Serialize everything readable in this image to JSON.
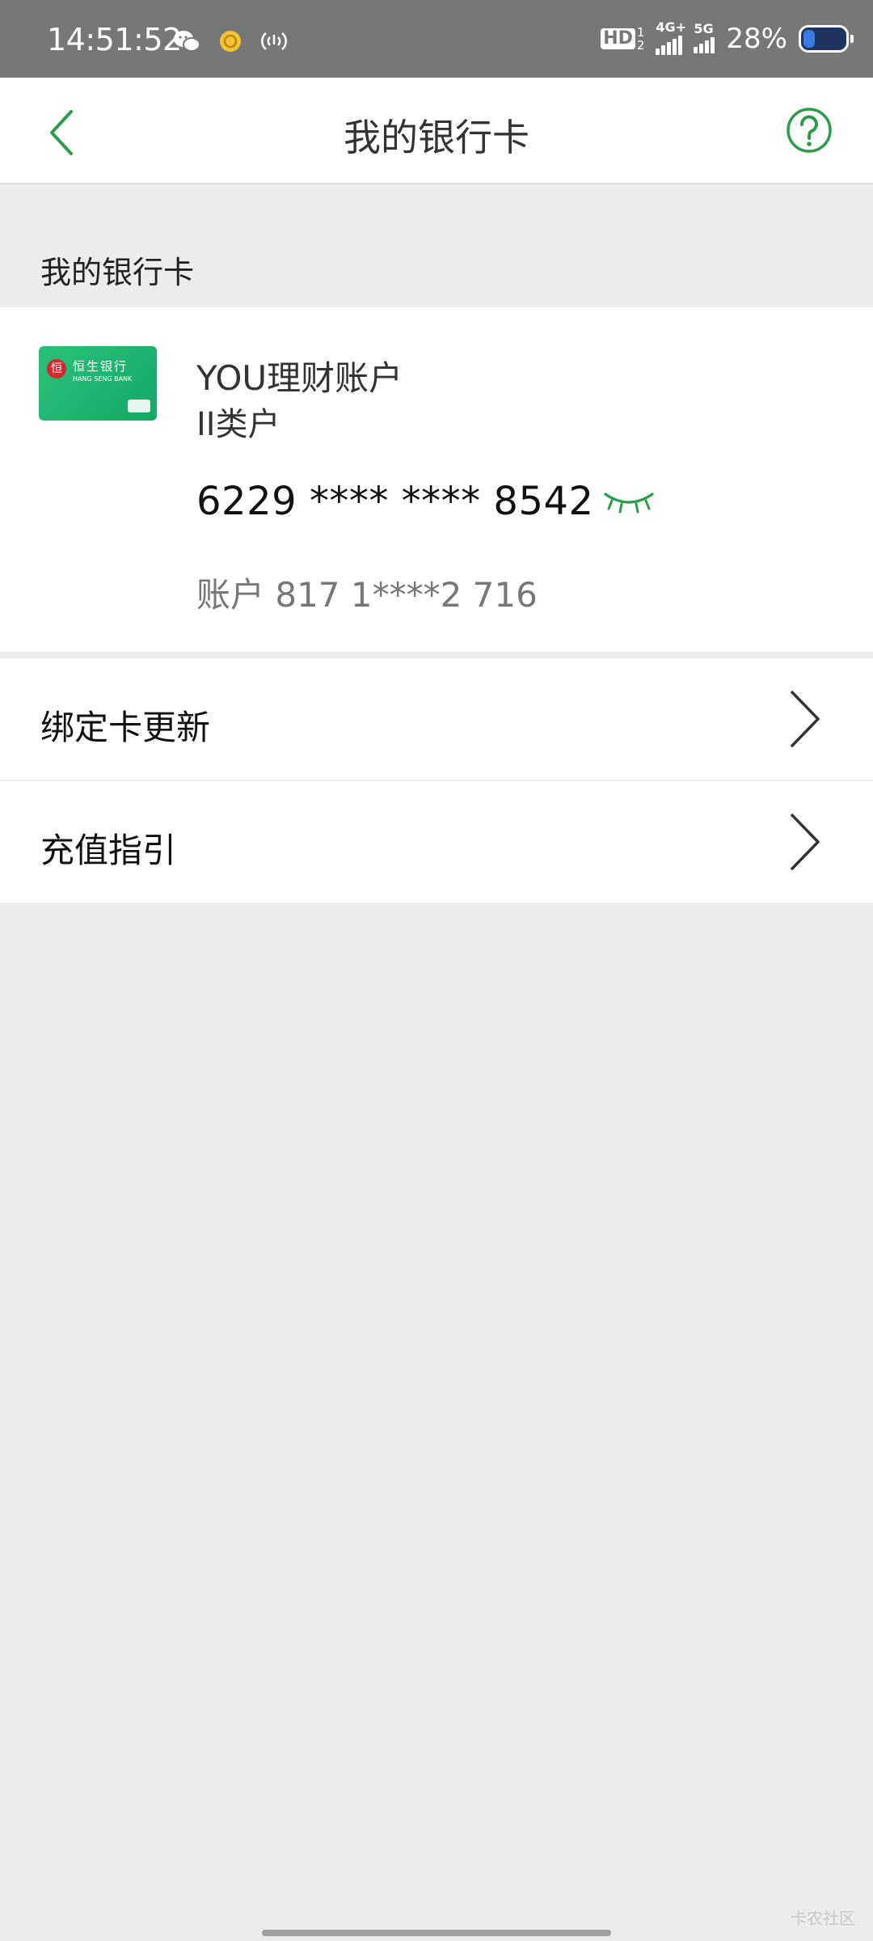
{
  "status_bar": {
    "time": "14:51:52",
    "hd_label": "HD",
    "hd_sub_top": "1",
    "hd_sub_bottom": "2",
    "network_1": "4G+",
    "network_2": "5G",
    "battery_percent": "28%",
    "battery_level": 0.28
  },
  "header": {
    "title": "我的银行卡"
  },
  "section": {
    "label": "我的银行卡"
  },
  "card": {
    "bank_name_cn": "恒生银行",
    "bank_name_en": "HANG SENG BANK",
    "logo_text": "恒",
    "account_name": "YOU理财账户",
    "account_type": "II类户",
    "card_number": "6229 **** **** 8542",
    "account_number": "账户 817 1****2 716",
    "accent_color": "#1fb26f"
  },
  "menu": {
    "items": [
      {
        "label": "绑定卡更新"
      },
      {
        "label": "充值指引"
      }
    ]
  },
  "footer": {
    "watermark": "卡农社区"
  },
  "icons": {
    "back": "chevron-left-icon",
    "help": "question-circle-icon",
    "eye": "eye-closed-icon",
    "menu_arrow": "chevron-right-icon"
  },
  "colors": {
    "brand_green": "#2a9d48",
    "status_bar": "#777777",
    "page_bg": "#ececec"
  }
}
